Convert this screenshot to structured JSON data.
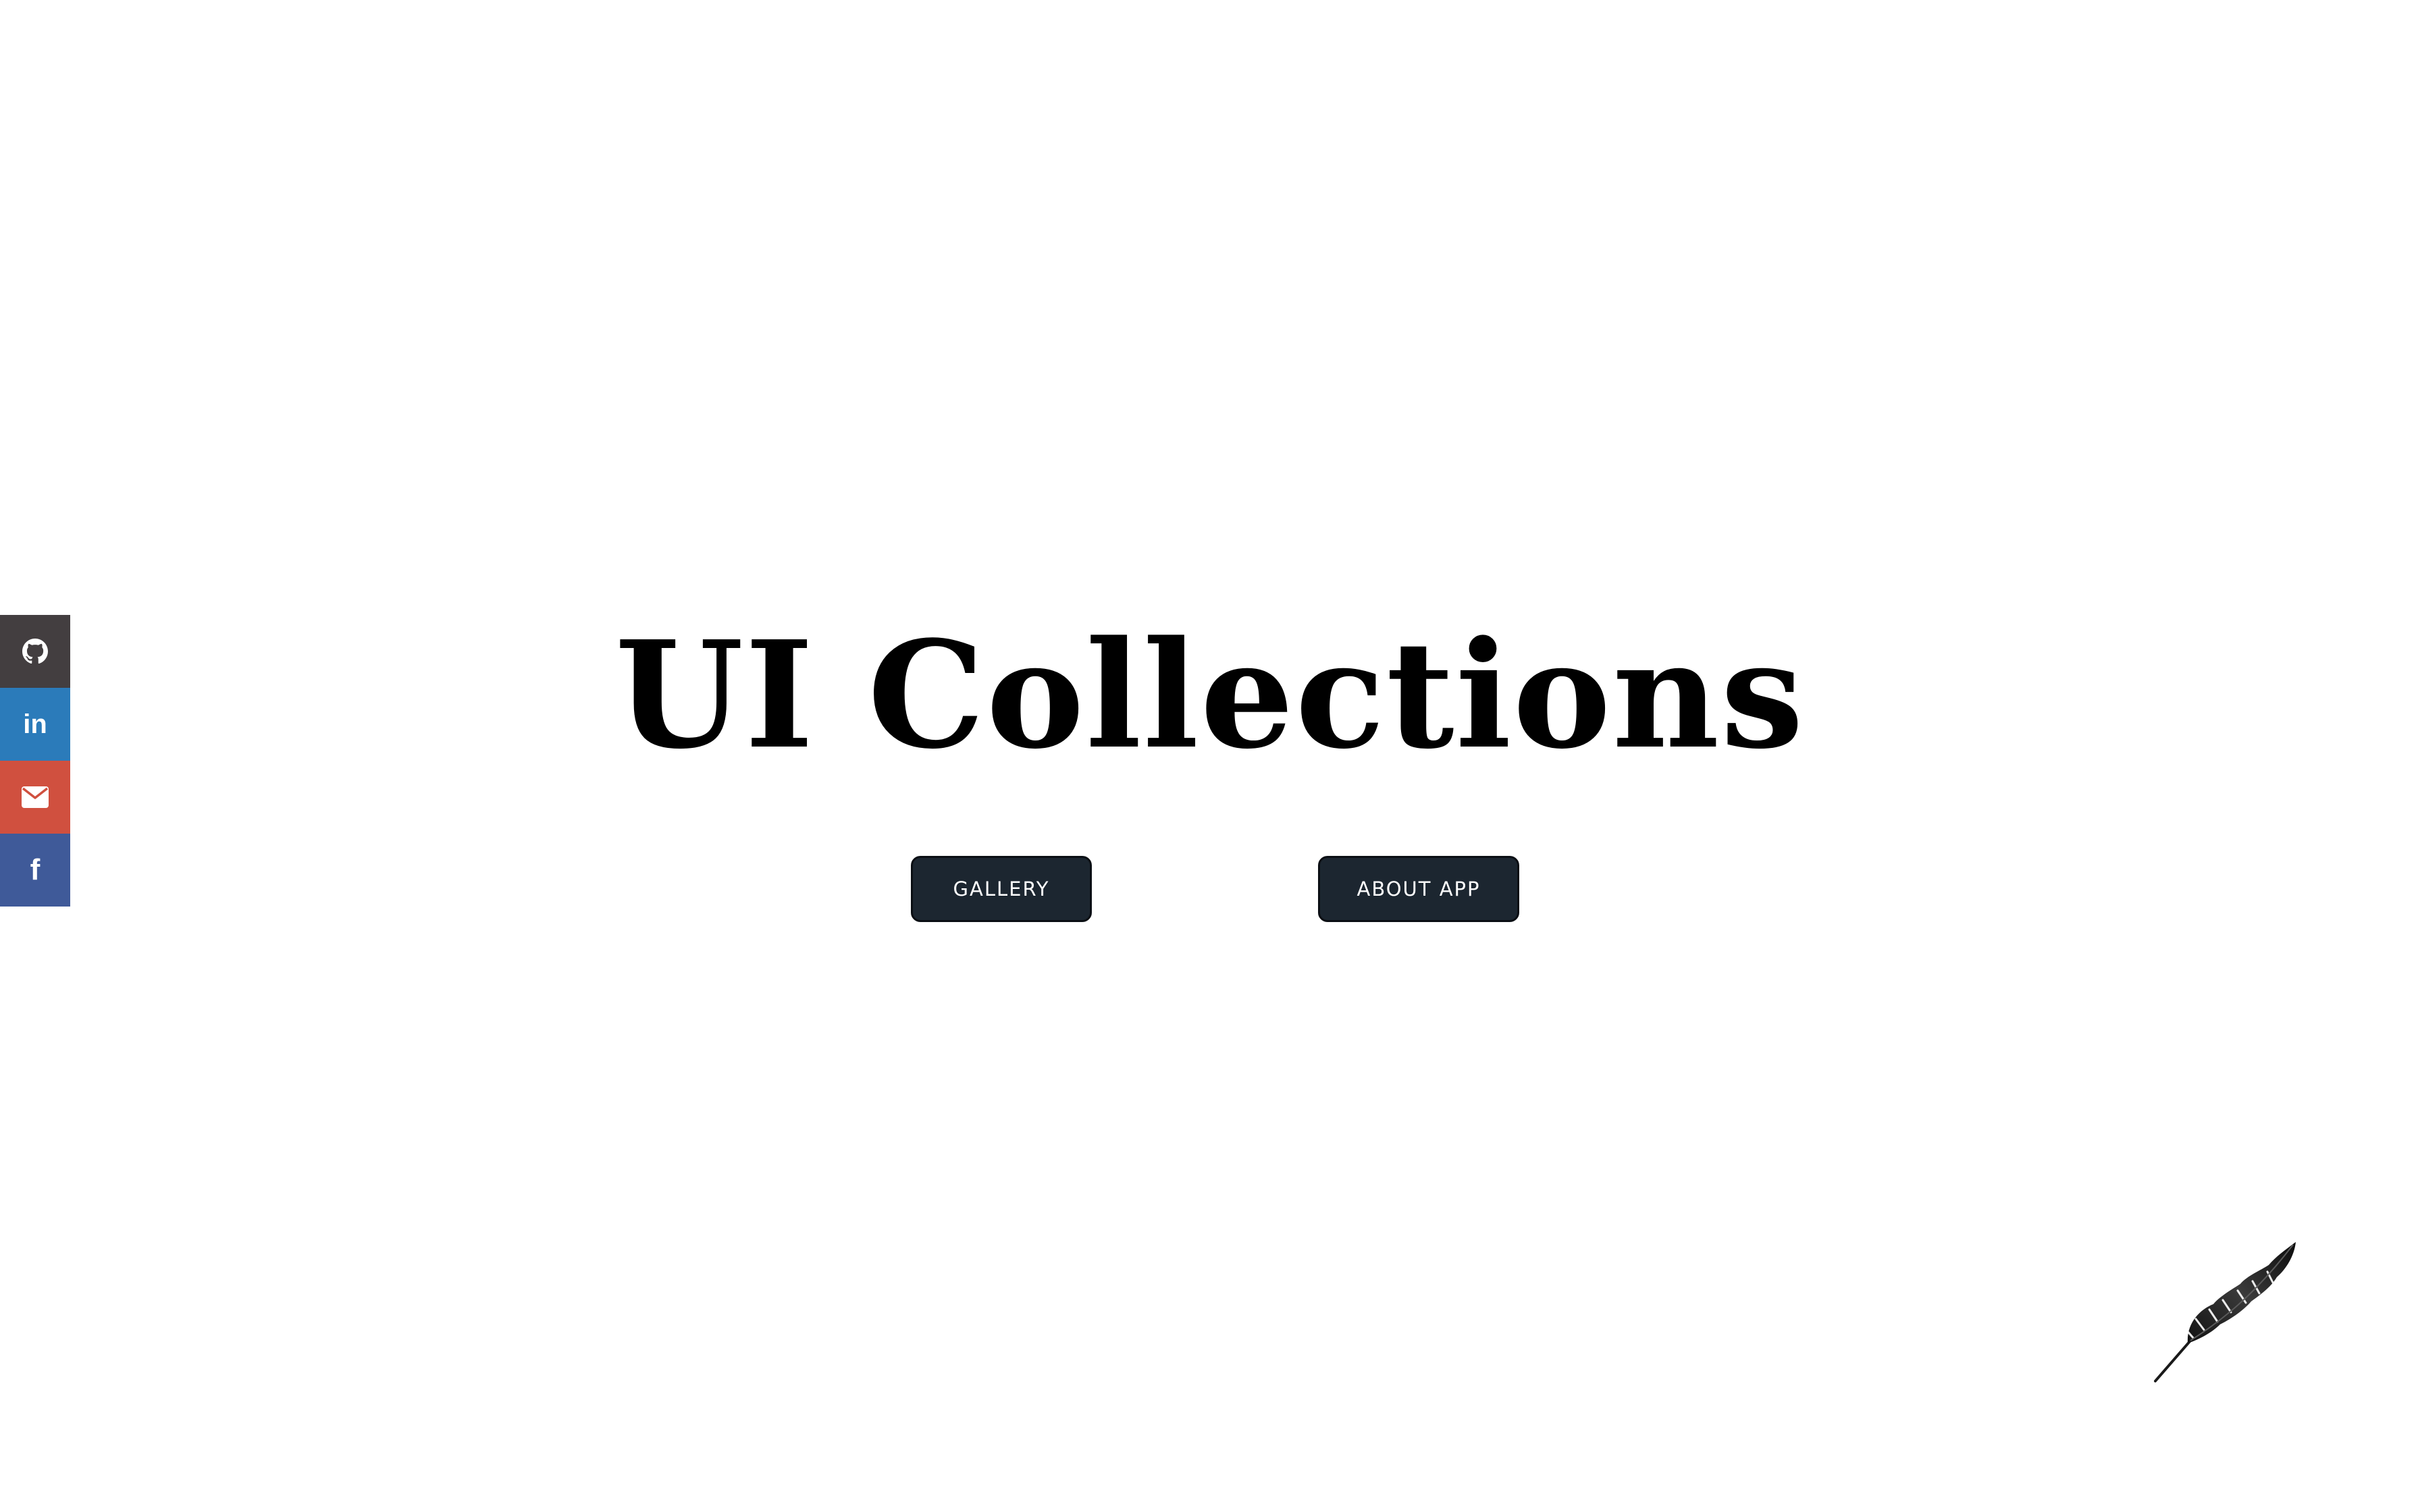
{
  "colors": {
    "background": "#ffffff",
    "title": "#000000",
    "button_bg": "#1c2630",
    "button_text": "#ffffff",
    "github": "#433e40",
    "linkedin": "#2b7bba",
    "email": "#d0503f",
    "facebook": "#3f5a99"
  },
  "social": [
    {
      "name": "github",
      "icon": "github-icon"
    },
    {
      "name": "linkedin",
      "icon": "linkedin-icon",
      "glyph": "in"
    },
    {
      "name": "email",
      "icon": "envelope-icon"
    },
    {
      "name": "facebook",
      "icon": "facebook-icon",
      "glyph": "f"
    }
  ],
  "hero": {
    "title": "UI Collections"
  },
  "buttons": {
    "gallery": "GALLERY",
    "about": "ABOUT APP"
  },
  "logo": {
    "icon": "feather-icon"
  }
}
